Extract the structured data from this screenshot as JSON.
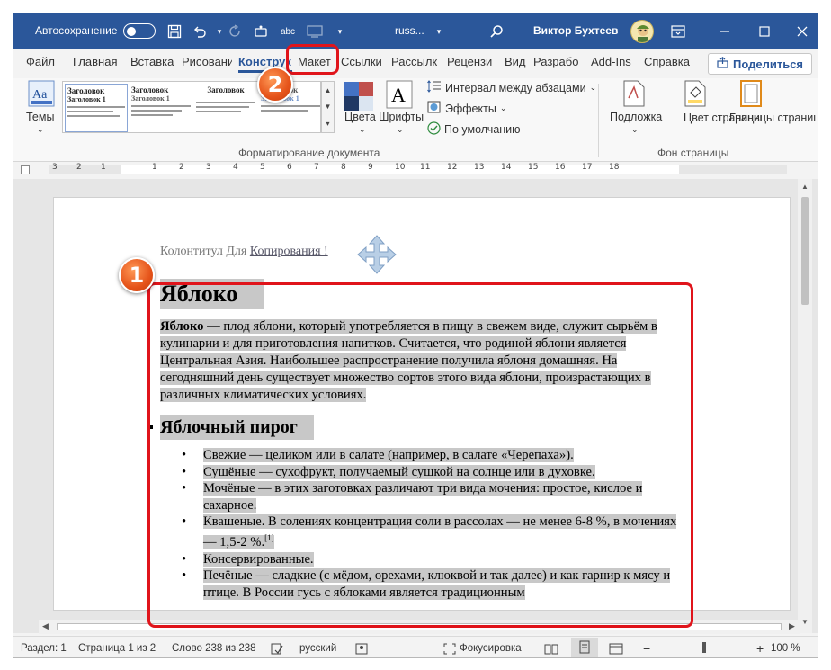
{
  "titlebar": {
    "autosave_label": "Автосохранение",
    "autosave_state": "off",
    "doc_name": "russ...",
    "user_name": "Виктор Бухтеев"
  },
  "tabs": [
    {
      "label": "Файл"
    },
    {
      "label": "Главная"
    },
    {
      "label": "Вставка"
    },
    {
      "label": "Рисовани"
    },
    {
      "label": "Конструк"
    },
    {
      "label": "Макет"
    },
    {
      "label": "Ссылки"
    },
    {
      "label": "Рассылк"
    },
    {
      "label": "Рецензи"
    },
    {
      "label": "Вид"
    },
    {
      "label": "Разрабо"
    },
    {
      "label": "Add-Ins"
    },
    {
      "label": "Справка"
    }
  ],
  "share_label": "Поделиться",
  "ribbon": {
    "themes_label": "Темы",
    "styles": [
      {
        "title": "Заголовок",
        "sub": "Заголовок 1"
      },
      {
        "title": "Заголовок",
        "sub": "Заголовок 1"
      },
      {
        "title": "Заголовок",
        "sub": ""
      },
      {
        "title": "Заголовок",
        "sub": "Заголовок 1"
      }
    ],
    "colors_label": "Цвета",
    "fonts_label": "Шрифты",
    "spacing_label": "Интервал между абзацами",
    "effects_label": "Эффекты",
    "default_label": "По умолчанию",
    "group_format_label": "Форматирование документа",
    "watermark_label": "Подложка",
    "page_color_label": "Цвет страницы",
    "page_borders_label": "Границы страниц",
    "group_bg_label": "Фон страницы"
  },
  "ruler_labels": [
    "3",
    "2",
    "1",
    "1",
    "2",
    "3",
    "4",
    "5",
    "6",
    "7",
    "8",
    "9",
    "10",
    "11",
    "12",
    "13",
    "14",
    "15",
    "16",
    "17",
    "18"
  ],
  "document": {
    "header_prefix": "Колонтитул Для ",
    "header_link": "Копирования !",
    "h1": "Яблоко",
    "para_bold": "Яблоко",
    "para_text": " — плод яблони, который употребляется в пищу в свежем виде, служит сырьём в кулинарии и для приготовления напитков. Считается, что родиной яблони является Центральная Азия. Наибольшее распространение получила яблоня домашняя. На сегодняшний день существует множество сортов этого вида яблони, произрастающих в различных климатических условиях.",
    "h2": "Яблочный пирог",
    "items": [
      "Свежие — целиком или в салате (например, в салате «Черепаха»).",
      "Сушёные — сухофрукт, получаемый сушкой на солнце или в духовке.",
      "Мочёные — в этих заготовках различают три вида мочения: простое, кислое и сахарное.",
      "Квашеные. В солениях концентрация соли в рассолах — не менее 6-8 %, в мочениях — 1,5-2 %.",
      "Консервированные.",
      "Печёные — сладкие (с мёдом, орехами, клюквой и так далее) и как гарнир к мясу и птице. В России гусь с яблоками является традиционным"
    ],
    "footnote": "[1]"
  },
  "statusbar": {
    "section": "Раздел: 1",
    "page": "Страница 1 из 2",
    "words": "Слово 238 из 238",
    "language": "русский",
    "focus": "Фокусировка",
    "zoom": "100 %"
  },
  "annotations": {
    "badge1": "1",
    "badge2": "2"
  },
  "colors": {
    "titlebar": "#2b579a",
    "accent": "#2b579a",
    "highlight_box": "#e0141b",
    "badge": "#e5531a",
    "selection": "#c8c8c8"
  }
}
